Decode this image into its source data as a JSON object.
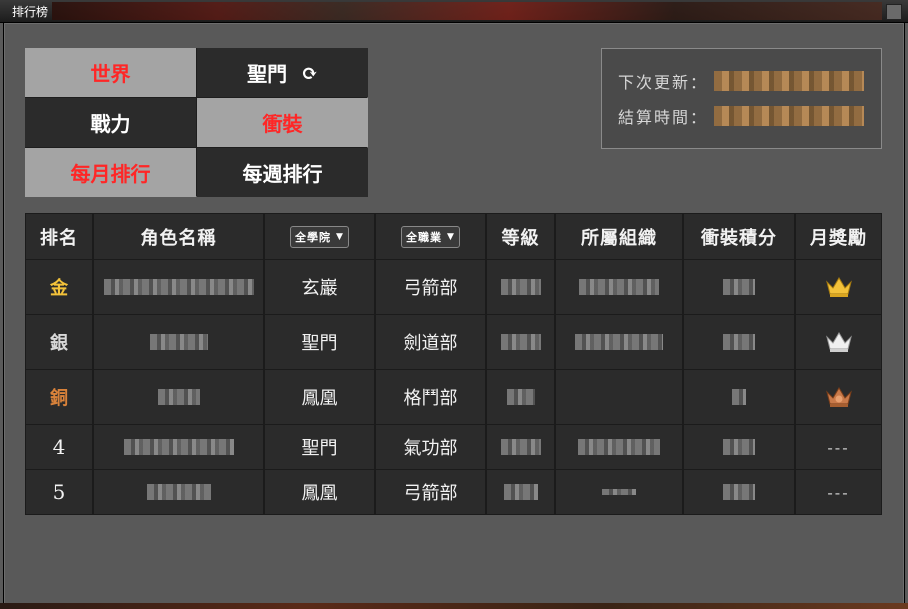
{
  "window": {
    "title": "排行榜"
  },
  "tabs": [
    {
      "label": "世界",
      "active": true
    },
    {
      "label": "聖門",
      "active": false,
      "has_refresh_icon": true
    },
    {
      "label": "戰力",
      "active": false
    },
    {
      "label": "衝裝",
      "active": true
    },
    {
      "label": "每月排行",
      "active": true
    },
    {
      "label": "每週排行",
      "active": false
    }
  ],
  "update_info": {
    "next_update_label": "下次更新：",
    "settle_time_label": "結算時間："
  },
  "table": {
    "headers": {
      "rank": "排名",
      "name": "角色名稱",
      "academy_select": "全學院",
      "class_select": "全職業",
      "level": "等級",
      "guild": "所屬組織",
      "score": "衝裝積分",
      "reward": "月獎勵"
    },
    "rows": [
      {
        "rank": "金",
        "rank_style": "gold",
        "academy": "玄巖",
        "class": "弓箭部",
        "reward": "gold-crown-icon"
      },
      {
        "rank": "銀",
        "rank_style": "silver",
        "academy": "聖門",
        "class": "劍道部",
        "reward": "silver-crown-icon"
      },
      {
        "rank": "銅",
        "rank_style": "bronze",
        "academy": "鳳凰",
        "class": "格鬥部",
        "reward": "bronze-crown-icon"
      },
      {
        "rank": "4",
        "rank_style": "number",
        "academy": "聖門",
        "class": "氣功部",
        "reward_text": "---"
      },
      {
        "rank": "5",
        "rank_style": "number",
        "academy": "鳳凰",
        "class": "弓箭部",
        "reward_text": "---"
      }
    ]
  },
  "colors": {
    "active_tab_text": "#ff2626",
    "gold": "#f3c23a",
    "silver": "#d8d8d8",
    "bronze": "#d9823a"
  }
}
